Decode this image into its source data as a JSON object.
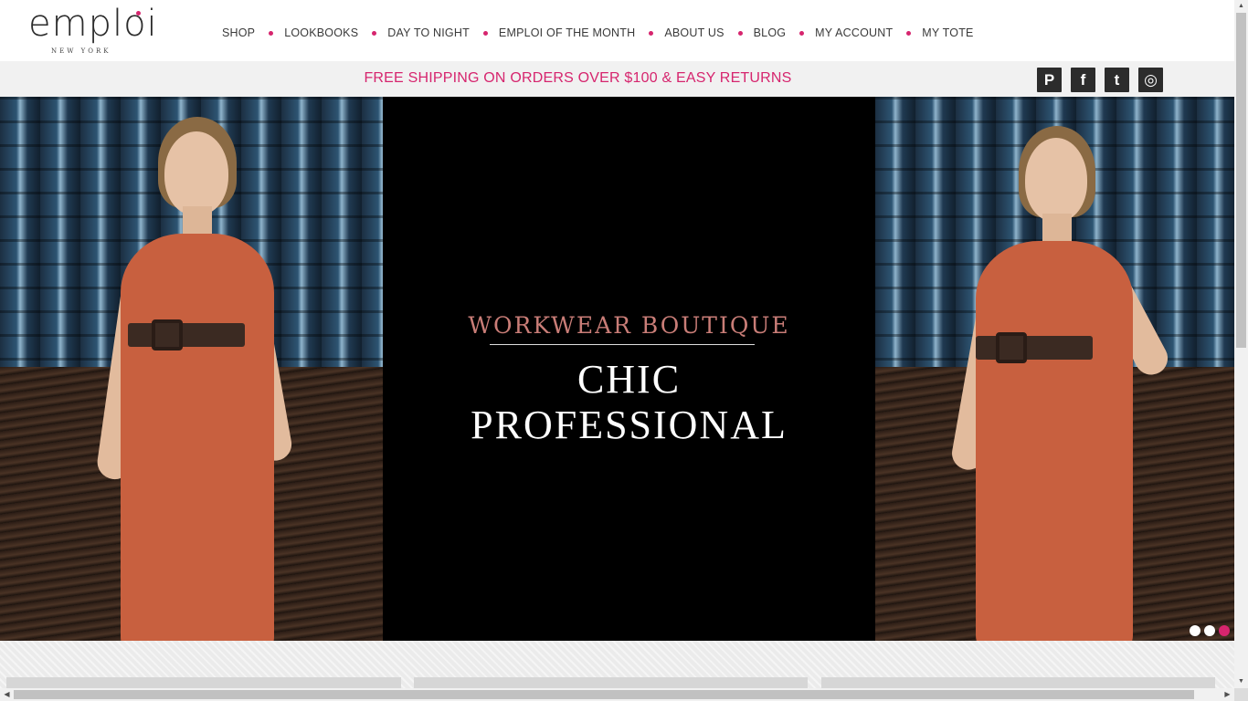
{
  "logo": {
    "word": "emploi",
    "sub": "NEW YORK"
  },
  "nav": [
    "SHOP",
    "LOOKBOOKS",
    "DAY TO NIGHT",
    "EMPLOI OF THE MONTH",
    "ABOUT US",
    "BLOG",
    "MY ACCOUNT",
    "MY TOTE"
  ],
  "shipping": {
    "text": "FREE SHIPPING ON ORDERS OVER $100 & EASY RETURNS"
  },
  "social": [
    {
      "name": "pinterest-icon",
      "glyph": "P"
    },
    {
      "name": "facebook-icon",
      "glyph": "f"
    },
    {
      "name": "twitter-icon",
      "glyph": "t"
    },
    {
      "name": "instagram-icon",
      "glyph": "◎"
    }
  ],
  "hero": {
    "tagline": "WORKWEAR BOUTIQUE",
    "title_line1": "CHIC",
    "title_line2": "PROFESSIONAL",
    "slide_count": 3,
    "active_slide": 3
  },
  "colors": {
    "accent": "#d6256e",
    "tagline": "#c97d77",
    "dress": "#c8603f"
  },
  "scrollbars": {
    "up": "▲",
    "down": "▼",
    "left": "◀",
    "right": "▶"
  }
}
